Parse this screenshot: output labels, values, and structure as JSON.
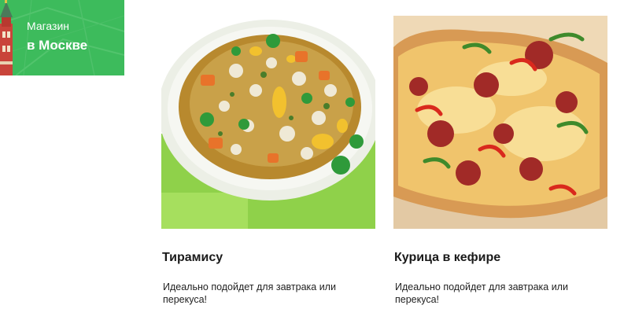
{
  "store_badge": {
    "line1": "Магазин",
    "line2": "в Москве",
    "icon": "kremlin-tower-icon",
    "color": "#3dbb5c"
  },
  "products": [
    {
      "title": "Тирамису",
      "description": "Идеально подойдет для завтрака или перекуса!",
      "image": "vegetable-soup-photo"
    },
    {
      "title": "Курица в кефире",
      "description": "Идеально подойдет для завтрака или перекуса!",
      "image": "pepperoni-pizza-photo"
    }
  ]
}
